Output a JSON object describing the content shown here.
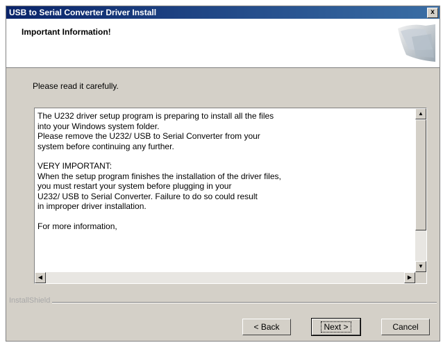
{
  "window": {
    "title": "USB to Serial Converter Driver Install",
    "close_label": "x"
  },
  "header": {
    "title": "Important Information!"
  },
  "subtitle": "Please read it carefully.",
  "info_text": {
    "paragraphs": [
      "The U232 driver setup program is preparing to install all the files\ninto your Windows system folder.\nPlease remove the U232/ USB to Serial Converter from your\nsystem before continuing any further.",
      "VERY IMPORTANT:\nWhen the setup program finishes the installation of the driver files,\nyou must restart your system before plugging in your\nU232/ USB to Serial Converter. Failure to do so could result\nin improper driver installation.",
      "For more information,"
    ]
  },
  "footer": {
    "brand": "InstallShield"
  },
  "buttons": {
    "back": "< Back",
    "next": "Next >",
    "cancel": "Cancel"
  }
}
